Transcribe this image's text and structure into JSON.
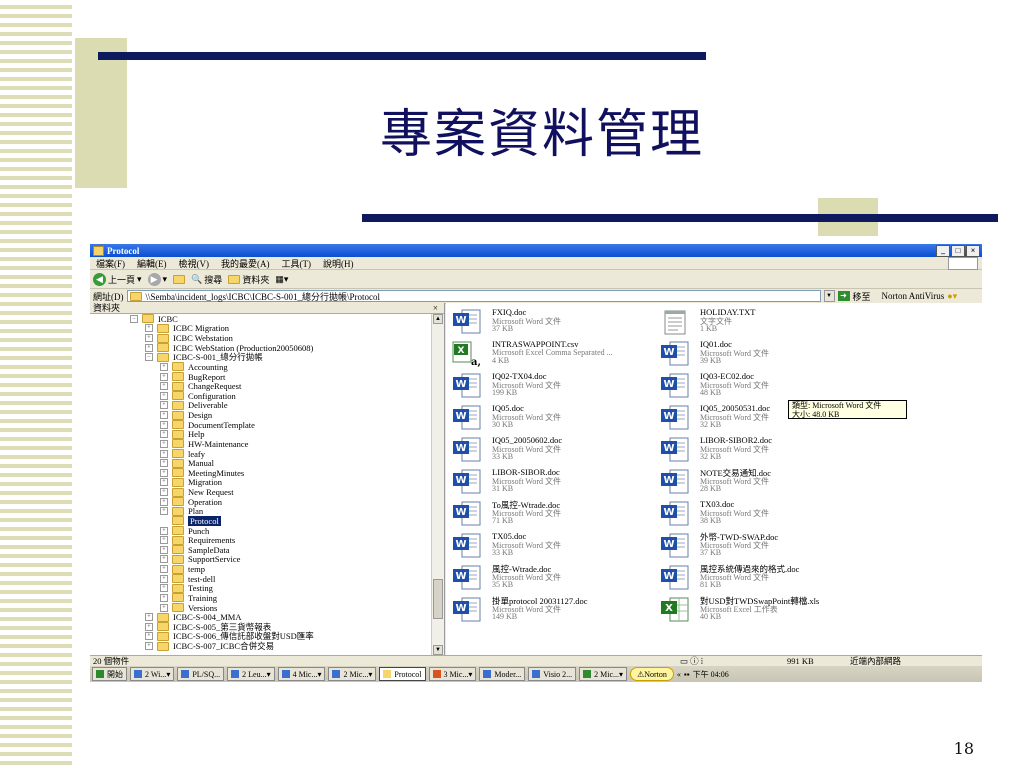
{
  "slide": {
    "title": "專案資料管理",
    "page_number": "18"
  },
  "window": {
    "title": "Protocol",
    "buttons": {
      "minimize": "_",
      "maximize": "□",
      "close": "×"
    },
    "menu": [
      "檔案(F)",
      "編輯(E)",
      "檢視(V)",
      "我的最愛(A)",
      "工具(T)",
      "說明(H)"
    ],
    "toolbar": {
      "back": "上一頁",
      "search": "搜尋",
      "folders": "資料夾"
    },
    "address": {
      "label": "網址(D)",
      "value": "\\\\Semba\\incident_logs\\ICBC\\ICBC-S-001_總分行拋帳\\Protocol",
      "go": "移至",
      "norton": "Norton AntiVirus"
    }
  },
  "tree": {
    "header": "資料夾",
    "close": "×",
    "nodes": [
      {
        "label": "ICBC",
        "level": 0,
        "pm": "−"
      },
      {
        "label": "ICBC Migration",
        "level": 1,
        "pm": "+"
      },
      {
        "label": "ICBC Webstation",
        "level": 1,
        "pm": "+"
      },
      {
        "label": "ICBC WebStation (Production20050608)",
        "level": 1,
        "pm": "+"
      },
      {
        "label": "ICBC-S-001_總分行拋帳",
        "level": 1,
        "pm": "−"
      },
      {
        "label": "Accounting",
        "level": 2,
        "pm": "+"
      },
      {
        "label": "BugReport",
        "level": 2,
        "pm": "+"
      },
      {
        "label": "ChangeRequest",
        "level": 2,
        "pm": "+"
      },
      {
        "label": "Configuration",
        "level": 2,
        "pm": "+"
      },
      {
        "label": "Deliverable",
        "level": 2,
        "pm": "+"
      },
      {
        "label": "Design",
        "level": 2,
        "pm": "+"
      },
      {
        "label": "DocumentTemplate",
        "level": 2,
        "pm": "+"
      },
      {
        "label": "Help",
        "level": 2,
        "pm": "+"
      },
      {
        "label": "HW-Maintenance",
        "level": 2,
        "pm": "+"
      },
      {
        "label": "leafy",
        "level": 2,
        "pm": "+"
      },
      {
        "label": "Manual",
        "level": 2,
        "pm": "+"
      },
      {
        "label": "MeetingMinutes",
        "level": 2,
        "pm": "+"
      },
      {
        "label": "Migration",
        "level": 2,
        "pm": "+"
      },
      {
        "label": "New Request",
        "level": 2,
        "pm": "+"
      },
      {
        "label": "Operation",
        "level": 2,
        "pm": "+"
      },
      {
        "label": "Plan",
        "level": 2,
        "pm": "+"
      },
      {
        "label": "Protocol",
        "level": 2,
        "pm": "",
        "selected": true
      },
      {
        "label": "Punch",
        "level": 2,
        "pm": "+"
      },
      {
        "label": "Requirements",
        "level": 2,
        "pm": "+"
      },
      {
        "label": "SampleData",
        "level": 2,
        "pm": "+"
      },
      {
        "label": "SupportService",
        "level": 2,
        "pm": "+"
      },
      {
        "label": "temp",
        "level": 2,
        "pm": "+"
      },
      {
        "label": "test-dell",
        "level": 2,
        "pm": "+"
      },
      {
        "label": "Testing",
        "level": 2,
        "pm": "+"
      },
      {
        "label": "Training",
        "level": 2,
        "pm": "+"
      },
      {
        "label": "Versions",
        "level": 2,
        "pm": "+"
      },
      {
        "label": "ICBC-S-004_MMA",
        "level": 1,
        "pm": "+"
      },
      {
        "label": "ICBC-S-005_第三貨幣報表",
        "level": 1,
        "pm": "+"
      },
      {
        "label": "ICBC-S-006_傳信託部收盤對USD匯率",
        "level": 1,
        "pm": "+"
      },
      {
        "label": "ICBC-S-007_ICBC合併交易",
        "level": 1,
        "pm": "+"
      }
    ]
  },
  "files": [
    {
      "name": "FXIQ.doc",
      "type": "Microsoft Word 文件",
      "size": "37 KB",
      "icon": "word"
    },
    {
      "name": "HOLIDAY.TXT",
      "type": "文字文件",
      "size": "1 KB",
      "icon": "text"
    },
    {
      "name": "INTRASWAPPOINT.csv",
      "type": "Microsoft Excel Comma Separated ...",
      "size": "4 KB",
      "icon": "csv"
    },
    {
      "name": "IQ01.doc",
      "type": "Microsoft Word 文件",
      "size": "39 KB",
      "icon": "word"
    },
    {
      "name": "IQ02-TX04.doc",
      "type": "Microsoft Word 文件",
      "size": "199 KB",
      "icon": "word"
    },
    {
      "name": "IQ03-EC02.doc",
      "type": "Microsoft Word 文件",
      "size": "48 KB",
      "icon": "word"
    },
    {
      "name": "IQ05.doc",
      "type": "Microsoft Word 文件",
      "size": "30 KB",
      "icon": "word"
    },
    {
      "name": "IQ05_20050531.doc",
      "type": "Microsoft Word 文件",
      "size": "32 KB",
      "icon": "word"
    },
    {
      "name": "IQ05_20050602.doc",
      "type": "Microsoft Word 文件",
      "size": "33 KB",
      "icon": "word"
    },
    {
      "name": "LIBOR-SIBOR2.doc",
      "type": "Microsoft Word 文件",
      "size": "32 KB",
      "icon": "word"
    },
    {
      "name": "LIBOR-SIBOR.doc",
      "type": "Microsoft Word 文件",
      "size": "31 KB",
      "icon": "word"
    },
    {
      "name": "NOTE交易通知.doc",
      "type": "Microsoft Word 文件",
      "size": "28 KB",
      "icon": "word"
    },
    {
      "name": "To風控-Wtrade.doc",
      "type": "Microsoft Word 文件",
      "size": "71 KB",
      "icon": "word"
    },
    {
      "name": "TX03.doc",
      "type": "Microsoft Word 文件",
      "size": "38 KB",
      "icon": "word"
    },
    {
      "name": "TX05.doc",
      "type": "Microsoft Word 文件",
      "size": "33 KB",
      "icon": "word"
    },
    {
      "name": "外幣-TWD-SWAP.doc",
      "type": "Microsoft Word 文件",
      "size": "37 KB",
      "icon": "word"
    },
    {
      "name": "風控-Wtrade.doc",
      "type": "Microsoft Word 文件",
      "size": "35 KB",
      "icon": "word"
    },
    {
      "name": "風控系統傳過來的格式.doc",
      "type": "Microsoft Word 文件",
      "size": "81 KB",
      "icon": "word"
    },
    {
      "name": "掛單protocol 20031127.doc",
      "type": "Microsoft Word 文件",
      "size": "149 KB",
      "icon": "word"
    },
    {
      "name": "對USD對TWDSwapPoint轉檔.xls",
      "type": "Microsoft Excel 工作表",
      "size": "40 KB",
      "icon": "excel"
    }
  ],
  "tooltip": {
    "line1": "類型: Microsoft Word 文件",
    "line2": "大小: 48.0 KB"
  },
  "status": {
    "count": "20 個物件",
    "size": "991 KB",
    "zone": "近端內部網路"
  },
  "taskbar": {
    "start": "開始",
    "tasks": [
      "2 Wi...",
      "PL/SQ...",
      "2 Leu...",
      "4 Mic...",
      "2 Mic...",
      "Protocol",
      "3 Mic...",
      "Moder...",
      "Visio 2...",
      "2 Mic..."
    ],
    "norton": "Norton",
    "clock": "下午 04:06"
  }
}
